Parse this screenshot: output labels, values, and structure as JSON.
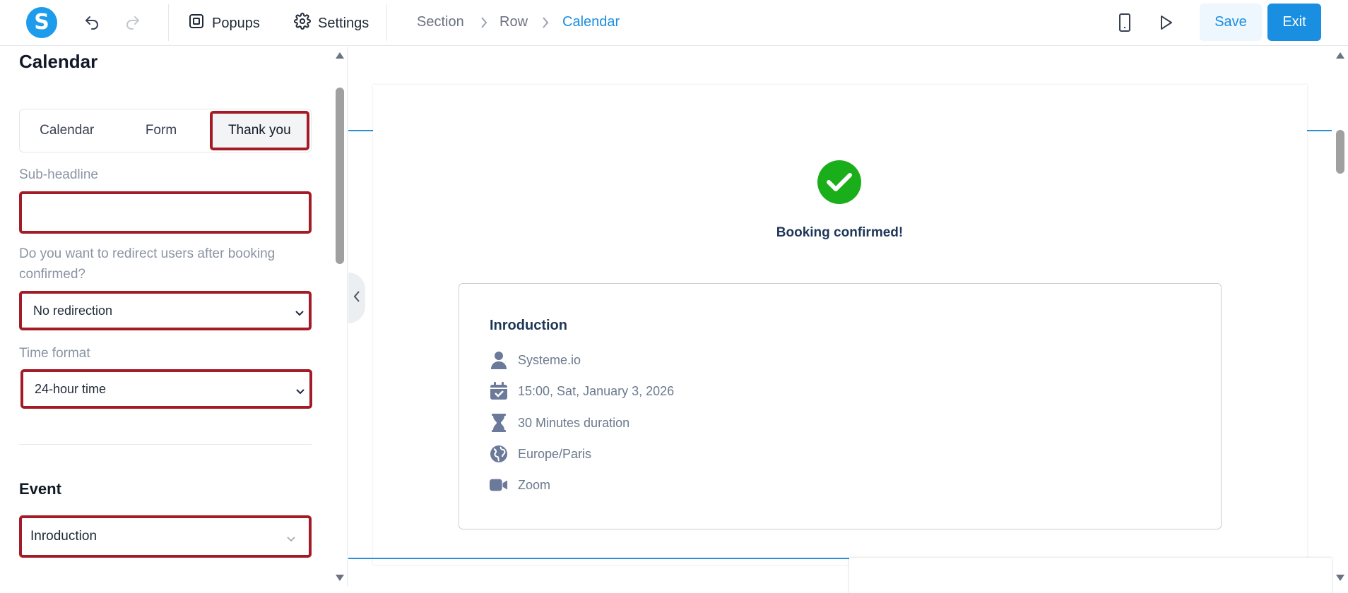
{
  "toolbar": {
    "logo_letter": "S",
    "popups_label": "Popups",
    "settings_label": "Settings",
    "breadcrumb": [
      "Section",
      "Row",
      "Calendar"
    ],
    "save_label": "Save",
    "exit_label": "Exit"
  },
  "panel": {
    "title": "Calendar",
    "tabs": [
      "Calendar",
      "Form",
      "Thank you"
    ],
    "active_tab": "Thank you",
    "subheadline_label": "Sub-headline",
    "subheadline_value": "",
    "redirect_label": "Do you want to redirect users after booking confirmed?",
    "redirect_value": "No redirection",
    "time_format_label": "Time format",
    "time_format_value": "24-hour time",
    "event_section": "Event",
    "event_value": "Inroduction"
  },
  "preview": {
    "confirm_text": "Booking confirmed!",
    "event_title": "Inroduction",
    "host": "Systeme.io",
    "datetime": "15:00, Sat, January 3, 2026",
    "duration": "30 Minutes duration",
    "timezone": "Europe/Paris",
    "location": "Zoom"
  },
  "colors": {
    "accent": "#1a8ee0",
    "highlight": "#a31b26",
    "success": "#1aae1a",
    "heading": "#1e3658"
  }
}
